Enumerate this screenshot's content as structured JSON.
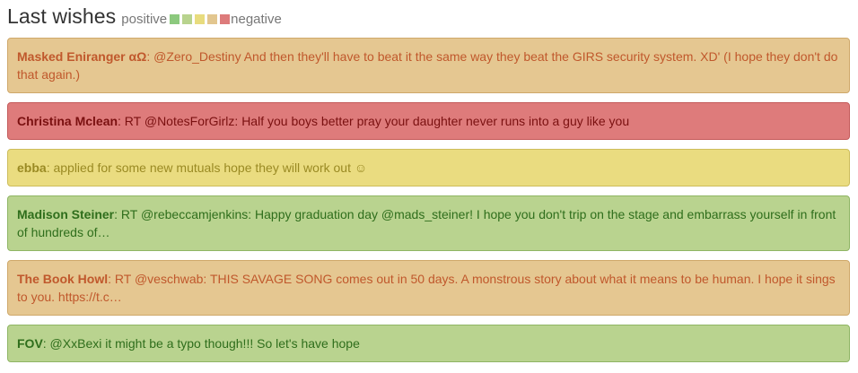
{
  "header": {
    "title": "Last wishes",
    "legend_positive": "positive",
    "legend_negative": "negative",
    "swatches": [
      "#8cc97e",
      "#b8d38e",
      "#e8dc7e",
      "#e2c68f",
      "#dd7b7b"
    ]
  },
  "cards": [
    {
      "author": "Masked Eniranger αΩ",
      "text": ": @Zero_Destiny And then they'll have to beat it the same way they beat the GIRS security system. XD' (I hope they don't do that again.)",
      "sentiment": "slightly-negative",
      "bg": "#e5c791",
      "border": "#cfa86a",
      "color": "#c0582c"
    },
    {
      "author": "Christina Mclean",
      "text": ": RT @NotesForGirlz: Half you boys better pray your daughter never runs into a guy like you",
      "sentiment": "negative",
      "bg": "#de7b7b",
      "border": "#c45b5b",
      "color": "#7a1010"
    },
    {
      "author": "ebba",
      "text": ": applied for some new mutuals hope they will work out ☺",
      "sentiment": "neutral",
      "bg": "#eadc80",
      "border": "#cdbd5c",
      "color": "#9a8a23"
    },
    {
      "author": "Madison Steiner",
      "text": ": RT @rebeccamjenkins: Happy graduation day @mads_steiner! I hope you don't trip on the stage and embarrass yourself in front of hundreds of…",
      "sentiment": "slightly-positive",
      "bg": "#b9d38f",
      "border": "#8fb564",
      "color": "#2f6e1c"
    },
    {
      "author": "The Book Howl",
      "text": ": RT @veschwab: THIS SAVAGE SONG comes out in 50 days. A monstrous story about what it means to be human. I hope it sings to you. https://t.c…",
      "sentiment": "slightly-negative",
      "bg": "#e5c791",
      "border": "#cfa86a",
      "color": "#c0582c"
    },
    {
      "author": "FOV",
      "text": ": @XxBexi it might be a typo though!!! So let's have hope",
      "sentiment": "slightly-positive",
      "bg": "#b9d38f",
      "border": "#8fb564",
      "color": "#2f6e1c"
    }
  ]
}
